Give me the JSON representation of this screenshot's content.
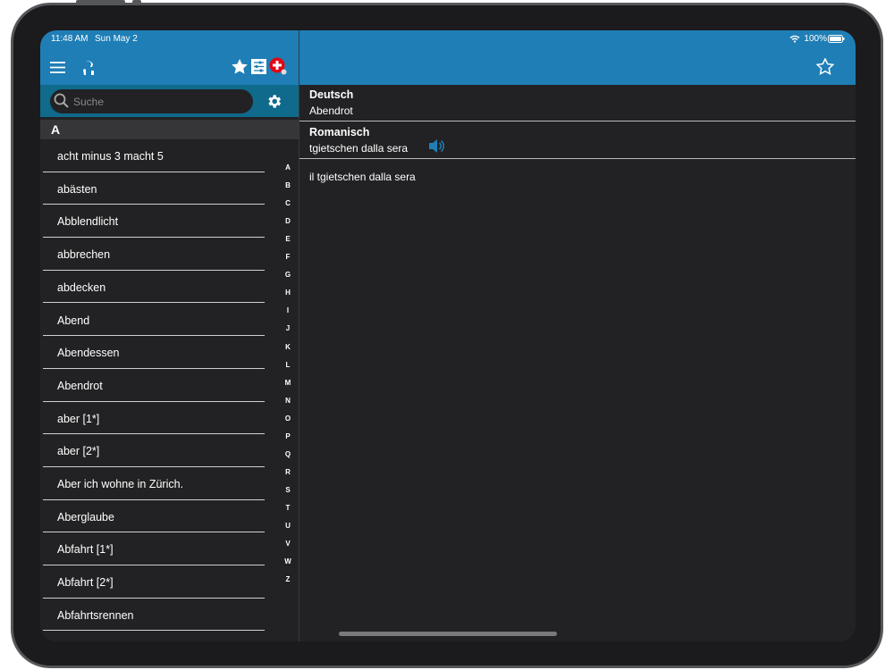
{
  "status": {
    "time": "11:48 AM",
    "date": "Sun May 2",
    "battery": "100%"
  },
  "search": {
    "placeholder": "Suche"
  },
  "section_letter": "A",
  "entries": [
    "acht minus 3 macht 5",
    "abästen",
    "Abblendlicht",
    "abbrechen",
    "abdecken",
    "Abend",
    "Abendessen",
    "Abendrot",
    "aber [1*]",
    "aber [2*]",
    "Aber ich wohne in Zürich.",
    "Aberglaube",
    "Abfahrt [1*]",
    "Abfahrt [2*]",
    "Abfahrtsrennen"
  ],
  "index": [
    "A",
    "B",
    "C",
    "D",
    "E",
    "F",
    "G",
    "H",
    "I",
    "J",
    "K",
    "L",
    "M",
    "N",
    "O",
    "P",
    "Q",
    "R",
    "S",
    "T",
    "U",
    "V",
    "W",
    "Z"
  ],
  "detail": {
    "lang1": "Deutsch",
    "word1": "Abendrot",
    "lang2": "Romanisch",
    "word2": "tgietschen dalla sera",
    "example": "il tgietschen dalla sera"
  },
  "colors": {
    "accent": "#1f7eb5",
    "search_bar": "#0f6a8c",
    "background": "#222224"
  }
}
